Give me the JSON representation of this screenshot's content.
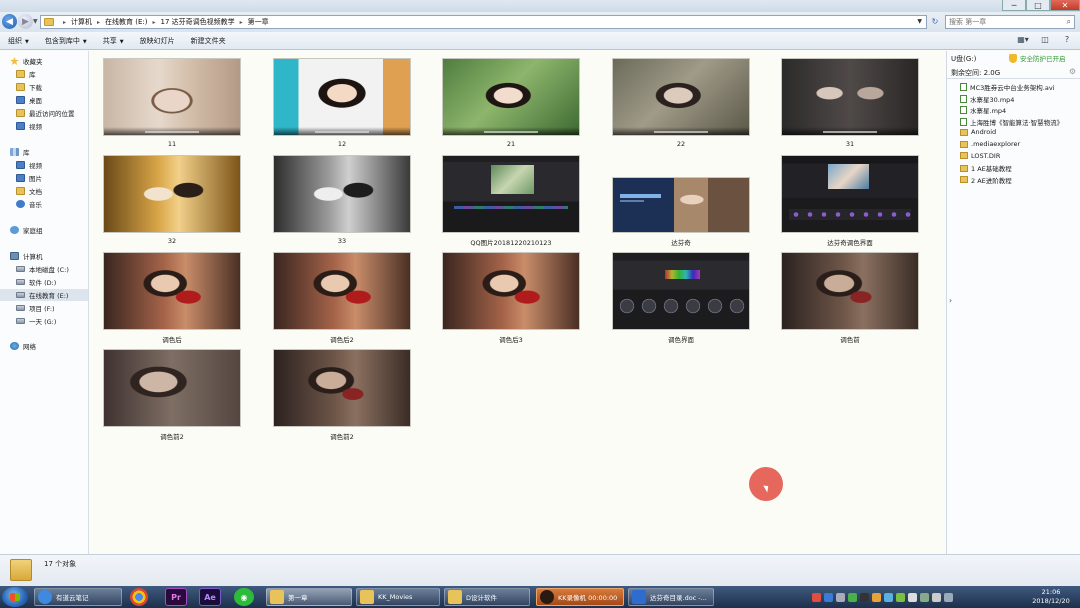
{
  "window": {
    "minimize": "─",
    "maximize": "□",
    "close": "✕"
  },
  "address": {
    "crumbs": [
      "计算机",
      "在线教育 (E:)",
      "17 达芬奇调色视频教学",
      "第一章"
    ],
    "search_placeholder": "搜索 第一章"
  },
  "toolbar": {
    "items": [
      "组织",
      "包含到库中",
      "共享",
      "放映幻灯片",
      "新建文件夹"
    ]
  },
  "sidebar": {
    "favorites": {
      "title": "收藏夹",
      "items": [
        "库",
        "下载",
        "桌面",
        "最近访问的位置",
        "视频"
      ]
    },
    "libraries": {
      "title": "库",
      "items": [
        "视频",
        "图片",
        "文档",
        "音乐"
      ]
    },
    "homegroup": "家庭组",
    "computer": {
      "title": "计算机",
      "items": [
        "本地磁盘 (C:)",
        "软件 (D:)",
        "在线教育 (E:)",
        "项目 (F:)",
        "一天 (G:)"
      ]
    },
    "network": "网络"
  },
  "files": [
    {
      "name": "11",
      "art": "art-warm"
    },
    {
      "name": "12",
      "art": "art-bright"
    },
    {
      "name": "21",
      "art": "art-green"
    },
    {
      "name": "22",
      "art": "art-muted"
    },
    {
      "name": "31",
      "art": "art-dark2"
    },
    {
      "name": "32",
      "art": "art-gold"
    },
    {
      "name": "33",
      "art": "art-bw"
    },
    {
      "name": "QQ图片20181220210123",
      "art": "art-ui"
    },
    {
      "name": "达芬奇",
      "art": "art-dav"
    },
    {
      "name": "达芬奇调色界面",
      "art": "art-ui2"
    },
    {
      "name": "调色后",
      "art": "art-red"
    },
    {
      "name": "调色后2",
      "art": "art-red"
    },
    {
      "name": "调色后3",
      "art": "art-red"
    },
    {
      "name": "调色界面",
      "art": "art-grade"
    },
    {
      "name": "调色前",
      "art": "art-red-dark"
    },
    {
      "name": "调色前2",
      "art": "art-red-muted"
    },
    {
      "name": "调色前2",
      "art": "art-red-dark"
    }
  ],
  "info_pane": {
    "drive": "U盘(G:)",
    "protect": "安全防护已开启",
    "free_space": "剩余空间: 2.0G",
    "items": [
      {
        "name": "MC3胜券云中台业务架构.avi",
        "type": "file"
      },
      {
        "name": "水寨星30.mp4",
        "type": "file"
      },
      {
        "name": "水寨星.mp4",
        "type": "file"
      },
      {
        "name": "上海胜博《智能算法·智慧物流》",
        "type": "file"
      },
      {
        "name": "Android",
        "type": "folder"
      },
      {
        "name": ".mediaexplorer",
        "type": "folder"
      },
      {
        "name": "LOST.DIR",
        "type": "folder"
      },
      {
        "name": "1 AE基础教程",
        "type": "folder"
      },
      {
        "name": "2 AE进阶教程",
        "type": "folder"
      }
    ]
  },
  "status": {
    "count": "17 个对象"
  },
  "taskbar": {
    "youdao": "有道云笔记",
    "pr": "Pr",
    "ae": "Ae",
    "tasks": [
      "第一章",
      "KK_Movies",
      "D设计软件",
      "KK录像机 00:00:00",
      "达芬奇目录.doc -..."
    ],
    "time": "21:06",
    "date": "2018/12/20"
  },
  "colors": {
    "accent": "#1d5fb3",
    "cursor_highlight": "#e24d42",
    "protect_green": "#2e9a2e"
  }
}
